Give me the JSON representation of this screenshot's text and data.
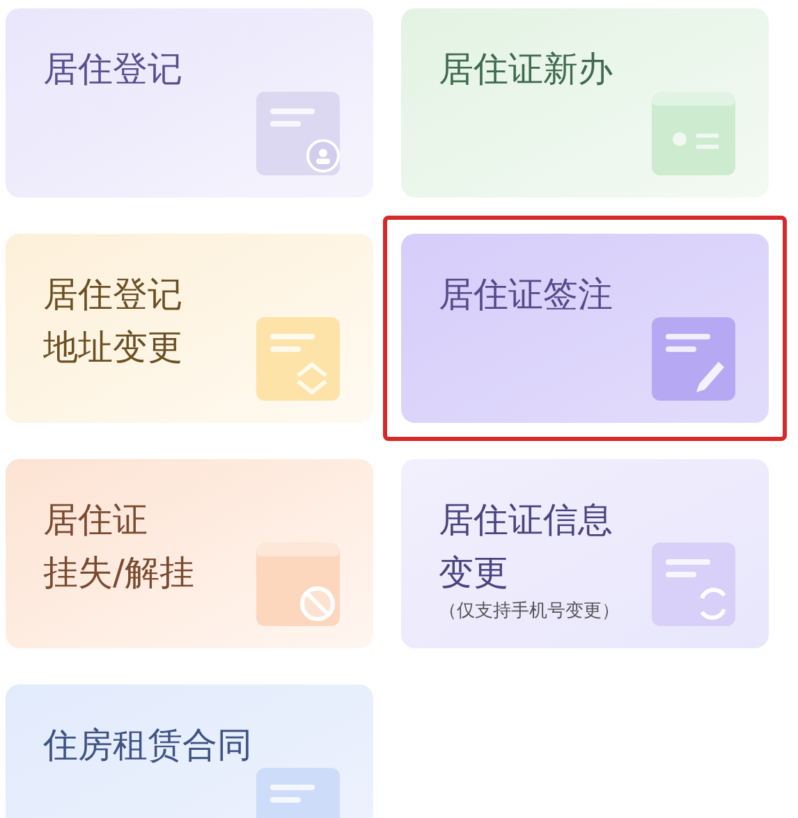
{
  "cards": [
    {
      "kind": "registration",
      "lines": [
        "居住登记"
      ],
      "selected": false
    },
    {
      "kind": "newcard",
      "lines": [
        "居住证新办"
      ],
      "selected": false
    },
    {
      "kind": "address",
      "lines": [
        "居住登记",
        "地址变更"
      ],
      "selected": false
    },
    {
      "kind": "endorsement",
      "lines": [
        "居住证签注"
      ],
      "selected": true
    },
    {
      "kind": "loss",
      "lines": [
        "居住证",
        "挂失/解挂"
      ],
      "selected": false
    },
    {
      "kind": "info",
      "lines": [
        "居住证信息",
        "变更"
      ],
      "note": "（仅支持手机号变更）",
      "selected": false
    },
    {
      "kind": "contract",
      "lines": [
        "住房租赁合同"
      ],
      "selected": false
    }
  ]
}
